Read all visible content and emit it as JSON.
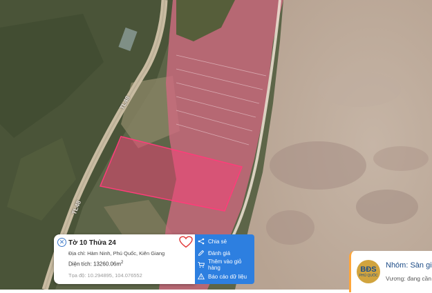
{
  "map": {
    "road_labels": [
      "TL48",
      "TL48"
    ]
  },
  "parcel_card": {
    "title": "Tờ 10 Thửa 24",
    "address": "Địa chỉ: Hàm Ninh, Phú Quốc, Kiên Giang",
    "area": "Diện tích: 13260.06m",
    "area_sup": "2",
    "coordinates": "Tọa độ: 10.294895, 104.076552"
  },
  "action_menu": {
    "items": [
      {
        "label": "Chia sẻ",
        "icon": "share-icon"
      },
      {
        "label": "Đánh giá",
        "icon": "pencil-icon"
      },
      {
        "label": "Thêm vào giỏ hàng",
        "icon": "cart-icon"
      },
      {
        "label": "Báo cáo dữ liệu",
        "icon": "warning-icon"
      }
    ]
  },
  "promo": {
    "avatar_text": "BĐS",
    "avatar_sub": "PHÚ QUỐC",
    "name": "Nhóm: Sàn gia",
    "status": "Vương: đang cần"
  },
  "colors": {
    "menu_bg": "#2d7fe0",
    "parcel_fill": "#ff3c7a",
    "heart": "#e23b3b",
    "promo_accent": "#ffa63a"
  }
}
